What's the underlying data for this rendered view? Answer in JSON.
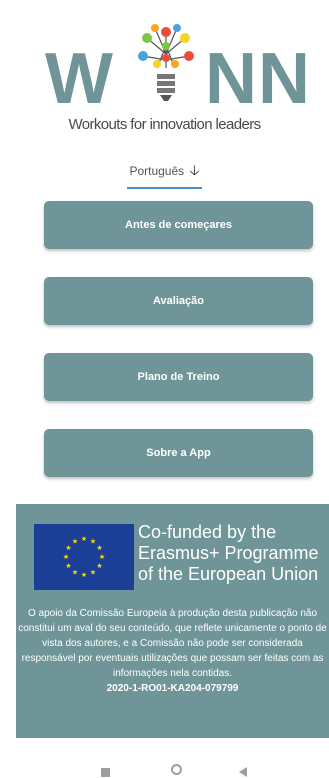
{
  "logo": {
    "letters": [
      "W",
      "N",
      "N"
    ],
    "tagline": "Workouts for innovation leaders"
  },
  "language": {
    "label": "Português",
    "icon": "arrow-down-icon"
  },
  "menu": {
    "buttons": [
      {
        "label": "Antes de começares"
      },
      {
        "label": "Avaliação"
      },
      {
        "label": "Plano de Treino"
      },
      {
        "label": "Sobre a App"
      }
    ]
  },
  "footer": {
    "cofunded_lines": [
      "Co-funded by the",
      "Erasmus+ Programme",
      "of the European Union"
    ],
    "disclaimer": "O apoio da Comissão Europeia à produção desta publicação não constitui um aval do seu conteúdo, que reflete unicamente o ponto de vista dos autores, e a Comissão não pode ser considerada responsável por eventuais utilizações que possam ser feitas com as informações nela contidas.",
    "project_code": "2020-1-RO01-KA204-079799"
  },
  "colors": {
    "brand": "#6f9599",
    "eu_blue": "#1b3f97",
    "eu_star": "#ffdd00",
    "underline": "#4a90c2"
  }
}
